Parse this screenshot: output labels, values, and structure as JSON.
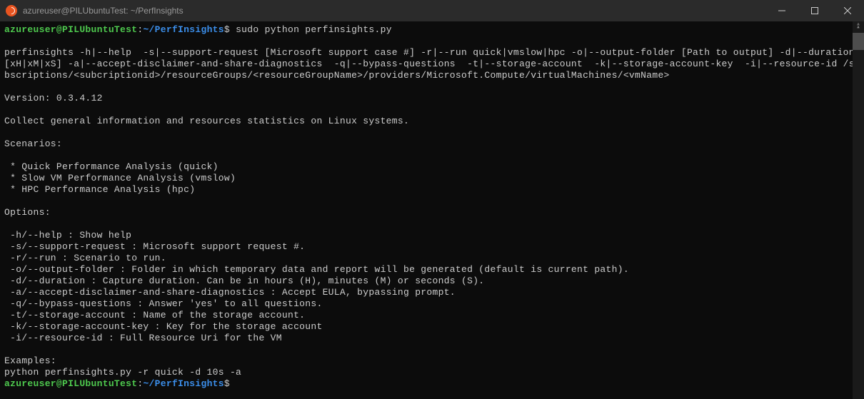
{
  "titlebar": {
    "title": "azureuser@PILUbuntuTest: ~/PerfInsights"
  },
  "prompt1": {
    "user": "azureuser@PILUbuntuTest",
    "colon": ":",
    "path": "~/PerfInsights",
    "dollar": "$",
    "command": " sudo python perfinsights.py"
  },
  "output": {
    "usage_line1": "perfinsights -h|--help  -s|--support-request [Microsoft support case #] -r|--run quick|vmslow|hpc -o|--output-folder [Path to output] -d|--duration",
    "usage_line2": "[xH|xM|xS] -a|--accept-disclaimer-and-share-diagnostics  -q|--bypass-questions  -t|--storage-account  -k|--storage-account-key  -i|--resource-id /su",
    "usage_line3": "bscriptions/<subcriptionid>/resourceGroups/<resourceGroupName>/providers/Microsoft.Compute/virtualMachines/<vmName>",
    "version": "Version: 0.3.4.12",
    "description": "Collect general information and resources statistics on Linux systems.",
    "scenarios_header": "Scenarios:",
    "scenario1": " * Quick Performance Analysis (quick)",
    "scenario2": " * Slow VM Performance Analysis (vmslow)",
    "scenario3": " * HPC Performance Analysis (hpc)",
    "options_header": "Options:",
    "opt_help": " -h/--help : Show help",
    "opt_support": " -s/--support-request : Microsoft support request #.",
    "opt_run": " -r/--run : Scenario to run.",
    "opt_output": " -o/--output-folder : Folder in which temporary data and report will be generated (default is current path).",
    "opt_duration": " -d/--duration : Capture duration. Can be in hours (H), minutes (M) or seconds (S).",
    "opt_accept": " -a/--accept-disclaimer-and-share-diagnostics : Accept EULA, bypassing prompt.",
    "opt_bypass": " -q/--bypass-questions : Answer 'yes' to all questions.",
    "opt_storage": " -t/--storage-account : Name of the storage account.",
    "opt_key": " -k/--storage-account-key : Key for the storage account",
    "opt_resource": " -i/--resource-id : Full Resource Uri for the VM",
    "examples_header": "Examples:",
    "example1": "python perfinsights.py -r quick -d 10s -a"
  },
  "prompt2": {
    "user": "azureuser@PILUbuntuTest",
    "colon": ":",
    "path": "~/PerfInsights",
    "dollar": "$"
  }
}
